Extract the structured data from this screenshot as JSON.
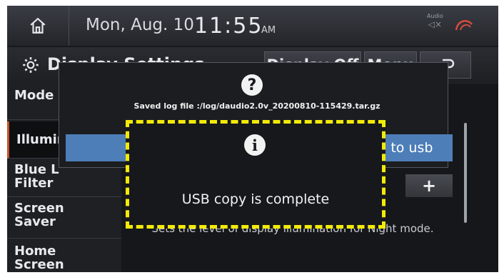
{
  "status_bar": {
    "date": "Mon, Aug. 10",
    "time": "11:55",
    "ampm": "AM",
    "audio_label": "Audio",
    "home_icon": "home-icon",
    "gps_icon": "gps-signal-icon"
  },
  "title_bar": {
    "title": "Display Settings",
    "display_off_label": "Display Off",
    "menu_label": "Menu",
    "back_icon": "back-arrow-icon"
  },
  "sidebar": {
    "items": [
      {
        "label": "Mode"
      },
      {
        "label": "Illumin"
      },
      {
        "label": "Blue L\nFilter"
      },
      {
        "label": "Screen\nSaver"
      },
      {
        "label": "Home\nScreen"
      }
    ]
  },
  "main": {
    "plus_label": "+",
    "description": "Sets the level of display illumination for Night mode."
  },
  "popup_outer": {
    "icon": "question-icon",
    "icon_glyph": "?",
    "message": "Saved log file :/log/daudio2.0v_20200810-115429.tar.gz",
    "right_button_label": "l to usb"
  },
  "popup_inner": {
    "icon": "info-icon",
    "icon_glyph": "i",
    "message": "USB copy is complete",
    "highlight_color": "#f3ea08"
  }
}
